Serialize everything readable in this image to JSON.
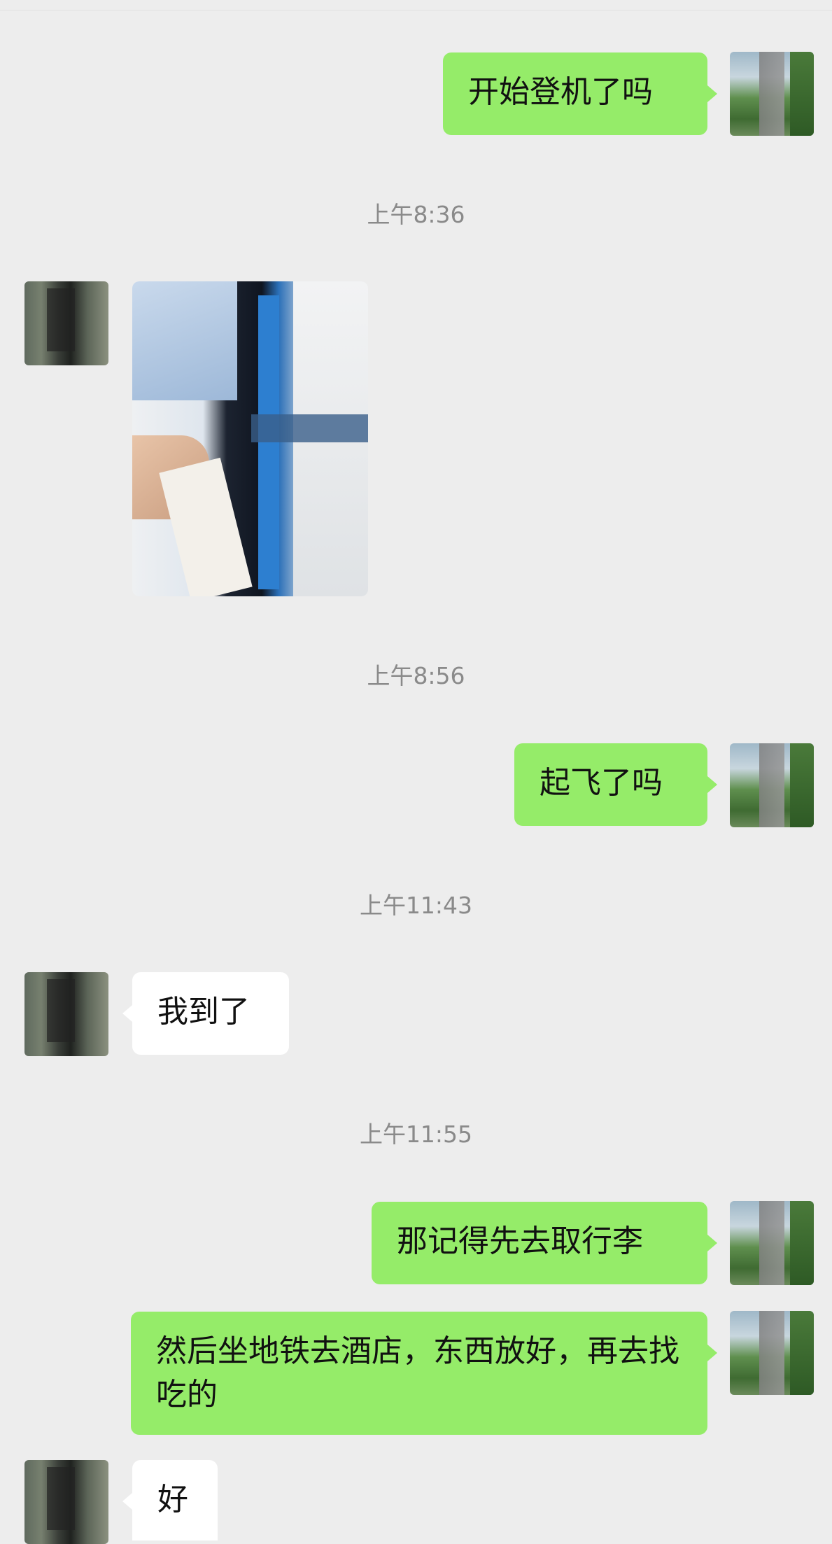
{
  "messages": [
    {
      "type": "text",
      "from": "self",
      "text": "开始登机了吗"
    },
    {
      "type": "timestamp",
      "text": "上午8:36"
    },
    {
      "type": "image",
      "from": "peer"
    },
    {
      "type": "timestamp",
      "text": "上午8:56"
    },
    {
      "type": "text",
      "from": "self",
      "text": "起飞了吗"
    },
    {
      "type": "timestamp",
      "text": "上午11:43"
    },
    {
      "type": "text",
      "from": "peer",
      "text": "我到了"
    },
    {
      "type": "timestamp",
      "text": "上午11:55"
    },
    {
      "type": "text",
      "from": "self",
      "text": "那记得先去取行李"
    },
    {
      "type": "text",
      "from": "self",
      "text": "然后坐地铁去酒店，东西放好，再去找吃的"
    },
    {
      "type": "text",
      "from": "peer",
      "text": "好"
    }
  ],
  "colors": {
    "background": "#ededed",
    "self_bubble": "#95ec69",
    "peer_bubble": "#ffffff",
    "timestamp_text": "#8a8a8a"
  }
}
